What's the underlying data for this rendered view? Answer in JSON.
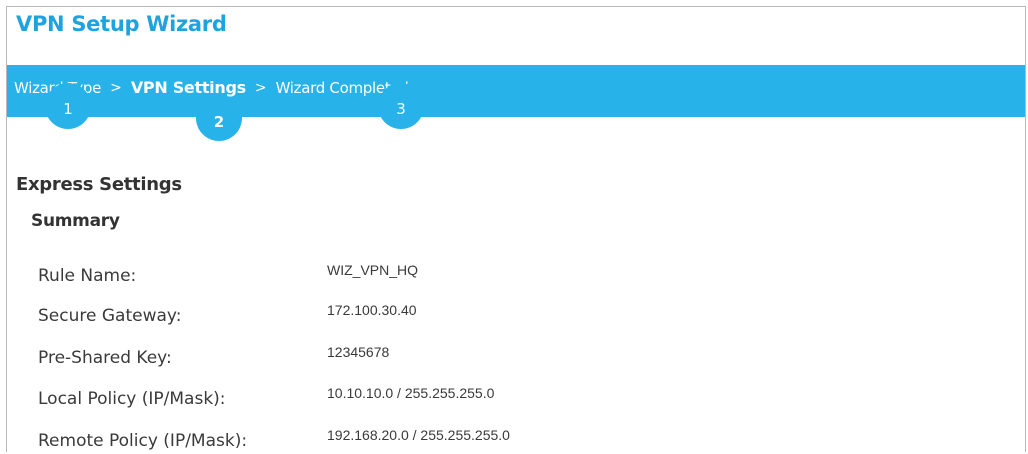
{
  "window": {
    "title": "VPN Setup Wizard"
  },
  "steps": [
    {
      "label": "Wizard Type",
      "number": "1",
      "active": false
    },
    {
      "label": "VPN Settings",
      "number": "2",
      "active": true
    },
    {
      "label": "Wizard Completed",
      "number": "3",
      "active": false
    }
  ],
  "step_separator": ">",
  "section_title": "Express Settings",
  "summary": {
    "title": "Summary",
    "rows": [
      {
        "label": "Rule Name:",
        "value": "WIZ_VPN_HQ"
      },
      {
        "label": "Secure Gateway:",
        "value": "172.100.30.40"
      },
      {
        "label": "Pre-Shared Key:",
        "value": "12345678"
      },
      {
        "label": "Local Policy (IP/Mask):",
        "value": "10.10.10.0 / 255.255.255.0"
      },
      {
        "label": "Remote Policy (IP/Mask):",
        "value": "192.168.20.0 / 255.255.255.0"
      }
    ]
  },
  "colors": {
    "accent": "#27b2ea",
    "title": "#1fa3df",
    "text": "#333333"
  }
}
